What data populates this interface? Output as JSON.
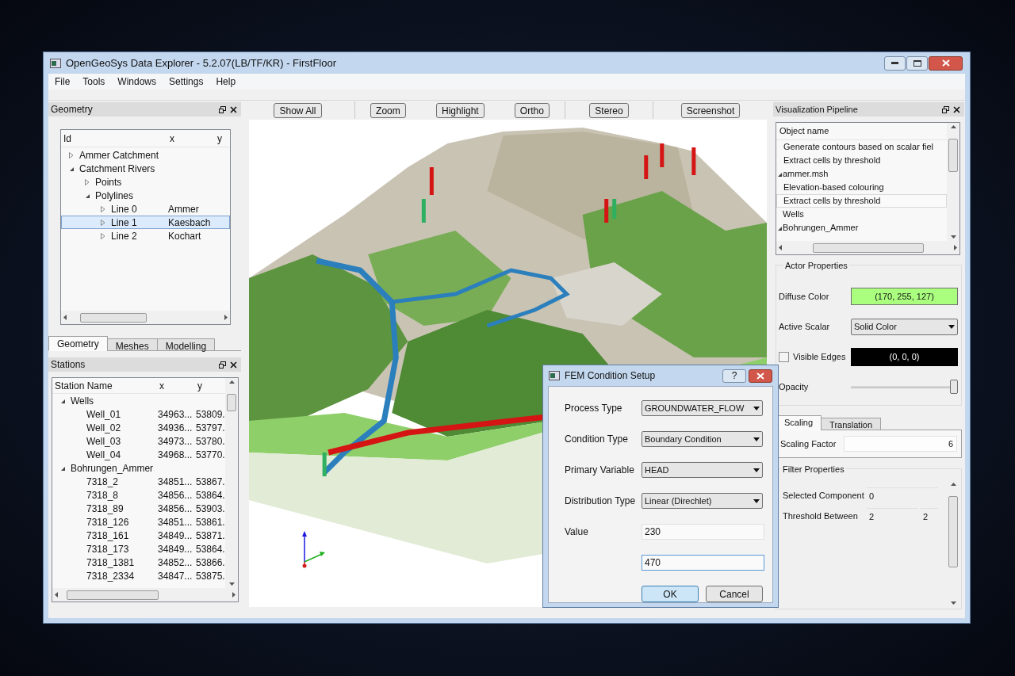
{
  "window": {
    "title": "OpenGeoSys Data Explorer - 5.2.07(LB/TF/KR) - FirstFloor"
  },
  "menu": [
    "File",
    "Tools",
    "Windows",
    "Settings",
    "Help"
  ],
  "toolbar": [
    [
      "Show All"
    ],
    [
      "Zoom",
      "Highlight",
      "Ortho"
    ],
    [
      "Stereo"
    ],
    [
      "Screenshot"
    ]
  ],
  "geometry": {
    "title": "Geometry",
    "columns": [
      "Id",
      "x",
      "y"
    ],
    "tree": [
      {
        "label": "Ammer Catchment",
        "expanded": false,
        "selected": false
      },
      {
        "label": "Catchment Rivers",
        "expanded": true,
        "selected": false,
        "children": [
          {
            "label": "Points",
            "expanded": false,
            "selected": false
          },
          {
            "label": "Polylines",
            "expanded": true,
            "selected": false,
            "children": [
              {
                "label": "Line 0",
                "cells": [
                  "Ammer"
                ],
                "expanded": false,
                "selected": false
              },
              {
                "label": "Line 1",
                "cells": [
                  "Kaesbach"
                ],
                "expanded": false,
                "selected": true
              },
              {
                "label": "Line 2",
                "cells": [
                  "Kochart"
                ],
                "expanded": false,
                "selected": false
              }
            ]
          }
        ]
      }
    ]
  },
  "left_tabs": [
    {
      "label": "Geometry",
      "selected": true
    },
    {
      "label": "Meshes",
      "selected": false
    },
    {
      "label": "Modelling",
      "selected": false
    }
  ],
  "stations": {
    "title": "Stations",
    "columns": [
      "Station Name",
      "x",
      "y"
    ],
    "tree": [
      {
        "label": "Wells",
        "expanded": true,
        "selected": false,
        "children": [
          {
            "label": "Well_01",
            "cells": [
              "34963...",
              "53809."
            ],
            "selected": false
          },
          {
            "label": "Well_02",
            "cells": [
              "34936...",
              "53797."
            ],
            "selected": false
          },
          {
            "label": "Well_03",
            "cells": [
              "34973...",
              "53780."
            ],
            "selected": false
          },
          {
            "label": "Well_04",
            "cells": [
              "34968...",
              "53770."
            ],
            "selected": false
          }
        ]
      },
      {
        "label": "Bohrungen_Ammer",
        "expanded": true,
        "selected": false,
        "children": [
          {
            "label": "7318_2",
            "cells": [
              "34851...",
              "53867."
            ],
            "selected": false
          },
          {
            "label": "7318_8",
            "cells": [
              "34856...",
              "53864."
            ],
            "selected": false
          },
          {
            "label": "7318_89",
            "cells": [
              "34856...",
              "53903."
            ],
            "selected": false
          },
          {
            "label": "7318_126",
            "cells": [
              "34851...",
              "53861."
            ],
            "selected": false
          },
          {
            "label": "7318_161",
            "cells": [
              "34849...",
              "53871."
            ],
            "selected": false
          },
          {
            "label": "7318_173",
            "cells": [
              "34849...",
              "53864."
            ],
            "selected": false
          },
          {
            "label": "7318_1381",
            "cells": [
              "34852...",
              "53866."
            ],
            "selected": false
          },
          {
            "label": "7318_2334",
            "cells": [
              "34847...",
              "53875."
            ],
            "selected": false
          }
        ]
      }
    ]
  },
  "pipeline": {
    "title": "Visualization Pipeline",
    "column": "Object name",
    "tree": [
      {
        "children": [
          {
            "label": "Generate contours based on scalar fiel",
            "selected": false
          },
          {
            "label": "Extract cells by threshold",
            "selected": false
          }
        ]
      },
      {
        "label": "ammer.msh",
        "expanded": true,
        "selected": false,
        "children": [
          {
            "label": "Elevation-based colouring",
            "selected": false
          },
          {
            "label": "Extract cells by threshold",
            "selected": true
          }
        ]
      },
      {
        "label": "Wells",
        "selected": false
      },
      {
        "label": "Bohrungen_Ammer",
        "expanded": true,
        "selected": false
      }
    ]
  },
  "actor_properties": {
    "title": "Actor Properties",
    "diffuse_color": {
      "label": "Diffuse Color",
      "value": "(170, 255, 127)",
      "color": "#aaff7f"
    },
    "active_scalar": {
      "label": "Active Scalar",
      "value": "Solid Color"
    },
    "visible_edges": {
      "label": "Visible Edges",
      "checked": false,
      "value": "(0, 0, 0)",
      "color": "#000000"
    },
    "opacity": {
      "label": "Opacity",
      "level": 1
    }
  },
  "transform_tabs": [
    {
      "label": "Scaling",
      "selected": true
    },
    {
      "label": "Translation",
      "selected": false
    }
  ],
  "scaling": {
    "label": "Scaling Factor",
    "value": "6"
  },
  "filter_properties": {
    "title": "Filter Properties",
    "rows": [
      {
        "label": "Selected Component",
        "values": [
          "0"
        ]
      },
      {
        "label": "Threshold Between",
        "values": [
          "2",
          "2"
        ]
      }
    ]
  },
  "dialog": {
    "title": "FEM Condition Setup",
    "help": "?",
    "rows": [
      {
        "kind": "select",
        "label": "Process Type",
        "value": "GROUNDWATER_FLOW"
      },
      {
        "kind": "select",
        "label": "Condition Type",
        "value": "Boundary Condition"
      },
      {
        "kind": "select",
        "label": "Primary Variable",
        "value": "HEAD"
      },
      {
        "kind": "select",
        "label": "Distribution Type",
        "value": "Linear (Direchlet)"
      },
      {
        "kind": "input",
        "label": "Value",
        "value": "230",
        "focused": false
      },
      {
        "kind": "input",
        "value": "470",
        "focused": true
      }
    ],
    "buttons": [
      {
        "label": "OK",
        "default": true
      },
      {
        "label": "Cancel",
        "default": false
      }
    ]
  }
}
